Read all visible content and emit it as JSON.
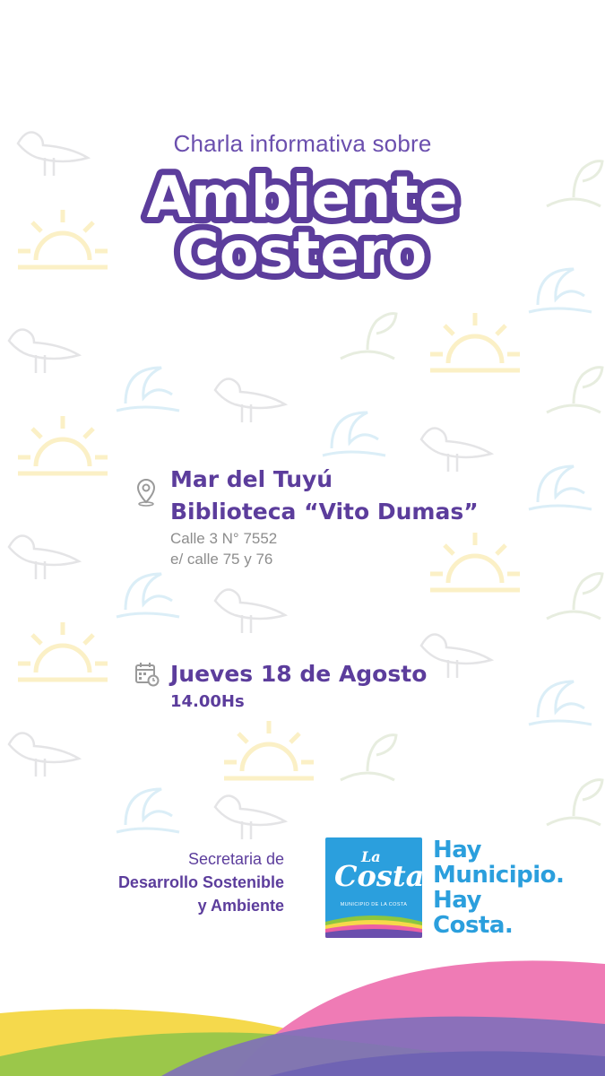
{
  "header": {
    "intro": "Charla informativa sobre",
    "title_line1": "Ambiente",
    "title_line2": "Costero"
  },
  "location": {
    "icon": "map-pin-icon",
    "city": "Mar del Tuyú",
    "venue": "Biblioteca “Vito Dumas”",
    "address_line1": "Calle 3 N° 7552",
    "address_line2": "e/ calle 75 y 76"
  },
  "schedule": {
    "icon": "calendar-icon",
    "date": "Jueves 18 de Agosto",
    "time": "14.00Hs"
  },
  "organizer": {
    "line1": "Secretaria de",
    "line2": "Desarrollo Sostenible",
    "line3": "y Ambiente"
  },
  "logo": {
    "la": "La",
    "costa": "Costa",
    "subtitle": "MUNICIPIO DE LA COSTA"
  },
  "slogan": {
    "line1": "Hay",
    "line2": "Municipio.",
    "line3": "Hay",
    "line4": "Costa."
  },
  "colors": {
    "purple": "#5c3d9c",
    "blue": "#2b9fdd",
    "yellow": "#f7d84a",
    "pink": "#ec5fa4",
    "green": "#8cc63f"
  }
}
